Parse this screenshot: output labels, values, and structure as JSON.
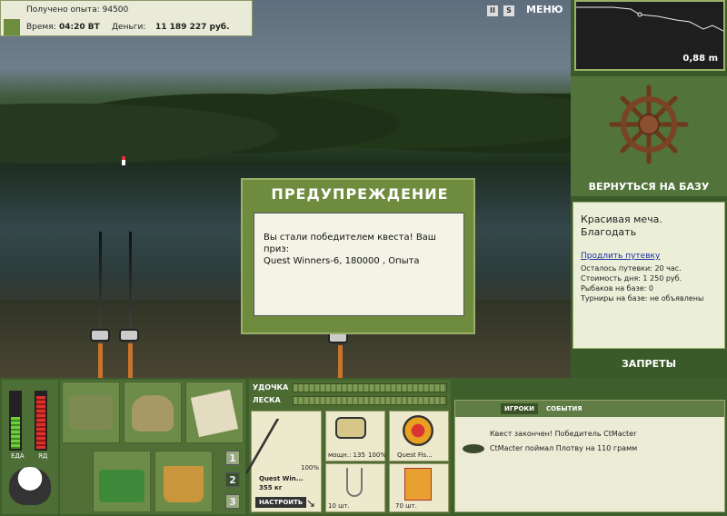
{
  "info": {
    "exp_label": "Получено опыта:",
    "exp_value": "94500",
    "time_label": "Время:",
    "time_value": "04:20 ВТ",
    "money_label": "Деньги:",
    "money_value": "11 189 227 руб."
  },
  "toolbar": {
    "pause": "II",
    "s": "S",
    "menu": "МЕНЮ"
  },
  "depth": {
    "value": "0,88 m"
  },
  "base": {
    "return_label": "ВЕРНУТЬСЯ НА БАЗУ"
  },
  "place": {
    "title_line1": "Красивая меча.",
    "title_line2": "Благодать",
    "extend_link": "Продлить путевку",
    "remaining": "Осталось путевки: 20 час.",
    "cost": "Стоимость дня: 1 250 руб.",
    "anglers": "Рыбаков на базе: 0",
    "tournaments": "Турниры на базе: не объявлены"
  },
  "bans": {
    "label": "ЗАПРЕТЫ"
  },
  "dialog": {
    "title": "ПРЕДУПРЕЖДЕНИЕ",
    "line1": "Вы стали победителем квеста! Ваш приз:",
    "line2": "Quest Winners-6, 180000 , Опыта"
  },
  "gauges": {
    "food_label": "ЕДА",
    "poison_label": "ЯД",
    "food_level": 0.55,
    "poison_level": 0.9
  },
  "tackle": {
    "rod_label": "УДОЧКА",
    "line_label": "ЛЕСКА",
    "rod_percent": "100%",
    "rod_name": "Quest Win...",
    "rod_weight": "355 кг",
    "setup_button": "НАСТРОИТЬ",
    "reel_power": "мощн.: 135",
    "reel_percent": "100%",
    "line_name": "Quest Fis...",
    "hooks_count": "10 шт.",
    "bait_count": "70 шт."
  },
  "slots": [
    "1",
    "2",
    "3"
  ],
  "events": {
    "tab_players": "ИГРОКИ",
    "tab_events": "СОБЫТИЯ",
    "items": [
      "Квест закончен! Победитель CtMacter",
      "CtMacter поймал Плотву на 110 грамм"
    ]
  }
}
